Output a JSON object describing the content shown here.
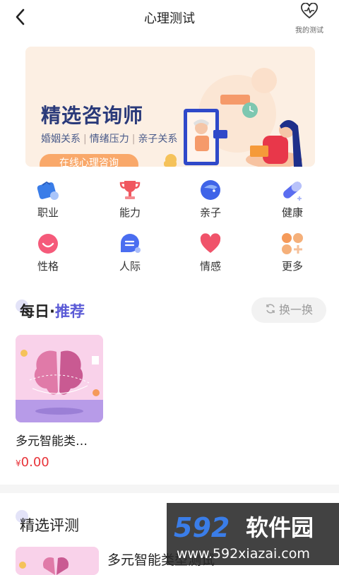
{
  "header": {
    "title": "心理测试",
    "my_test_label": "我的测试"
  },
  "banner": {
    "title": "精选咨询师",
    "tags": [
      "婚姻关系",
      "情绪压力",
      "亲子关系"
    ],
    "button_label": "在线心理咨询"
  },
  "categories": [
    {
      "label": "职业",
      "icon": "briefcase-icon",
      "color": "#4a8df0"
    },
    {
      "label": "能力",
      "icon": "trophy-icon",
      "color": "#f0575f"
    },
    {
      "label": "亲子",
      "icon": "dolphin-icon",
      "color": "#4a6df0"
    },
    {
      "label": "健康",
      "icon": "capsule-icon",
      "color": "#6a7df5"
    },
    {
      "label": "性格",
      "icon": "smile-icon",
      "color": "#f55a7a"
    },
    {
      "label": "人际",
      "icon": "chat-bubble-icon",
      "color": "#5a7df5"
    },
    {
      "label": "情感",
      "icon": "heart-icon",
      "color": "#f05a6a"
    },
    {
      "label": "更多",
      "icon": "more-grid-icon",
      "color": "#f59a5a"
    }
  ],
  "daily": {
    "title_main": "每日",
    "title_dot": "·",
    "title_accent": "推荐",
    "refresh_label": "换一换",
    "item": {
      "name": "多元智能类…",
      "currency": "¥",
      "price": "0.00"
    }
  },
  "featured": {
    "title": "精选评测",
    "item": {
      "name": "多元智能类型测试"
    }
  },
  "watermark": {
    "brand": "592软件园",
    "url": "www.592xiazai.com"
  },
  "colors": {
    "accent": "#5a5ad6",
    "price": "#e8343a",
    "banner_bg": "#fcefe3"
  }
}
